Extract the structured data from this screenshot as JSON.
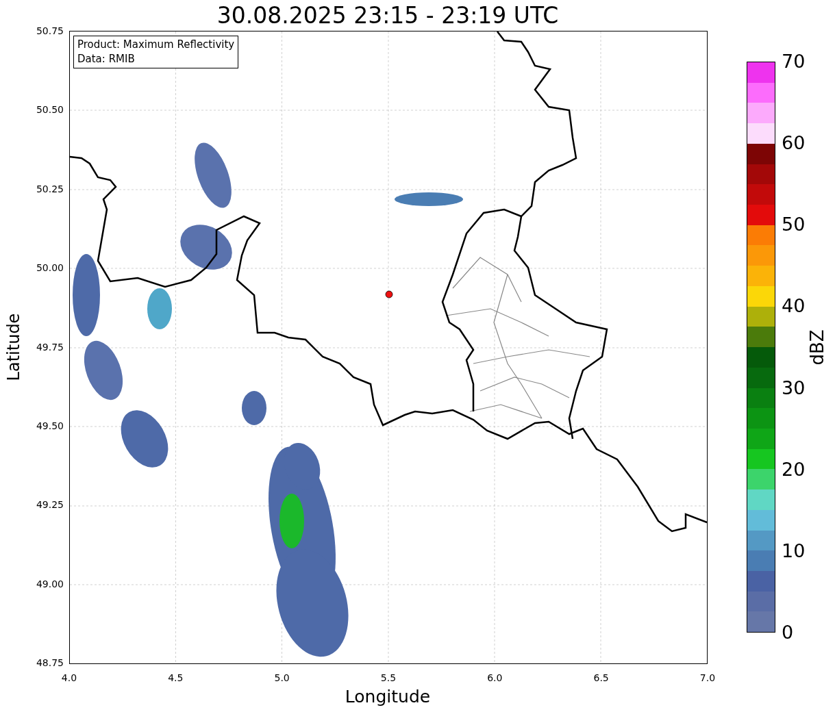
{
  "title": "30.08.2025 23:15 - 23:19 UTC",
  "info_box": [
    "Product: Maximum Reflectivity",
    "Data: RMIB"
  ],
  "x_axis": {
    "label": "Longitude",
    "ticks": [
      "4.0",
      "4.5",
      "5.0",
      "5.5",
      "6.0",
      "6.5",
      "7.0"
    ]
  },
  "y_axis": {
    "label": "Latitude",
    "ticks": [
      "50.75",
      "50.50",
      "50.25",
      "50.00",
      "49.75",
      "49.50",
      "49.25",
      "49.00",
      "48.75"
    ]
  },
  "colorbar": {
    "label": "dBZ",
    "ticks": [
      "70",
      "60",
      "50",
      "40",
      "30",
      "20",
      "10",
      "0"
    ],
    "segments": [
      {
        "color": "#ee33ee"
      },
      {
        "color": "#fc6cfc"
      },
      {
        "color": "#fcaafc"
      },
      {
        "color": "#fcdcfc"
      },
      {
        "color": "#7d0505"
      },
      {
        "color": "#a30808"
      },
      {
        "color": "#c20a0a"
      },
      {
        "color": "#e30b0b"
      },
      {
        "color": "#fb7c05"
      },
      {
        "color": "#fb9808"
      },
      {
        "color": "#fbb308"
      },
      {
        "color": "#fbd708"
      },
      {
        "color": "#adb00a"
      },
      {
        "color": "#4b7b0b"
      },
      {
        "color": "#055a0a"
      },
      {
        "color": "#076a0e"
      },
      {
        "color": "#0a8011"
      },
      {
        "color": "#0c9413"
      },
      {
        "color": "#0fa617"
      },
      {
        "color": "#16c620"
      },
      {
        "color": "#3cd46b"
      },
      {
        "color": "#60d7c4"
      },
      {
        "color": "#62bcd9"
      },
      {
        "color": "#5499c4"
      },
      {
        "color": "#4a7db3"
      },
      {
        "color": "#4a62a4"
      },
      {
        "color": "#5a6da6"
      },
      {
        "color": "#6677a8"
      }
    ]
  }
}
